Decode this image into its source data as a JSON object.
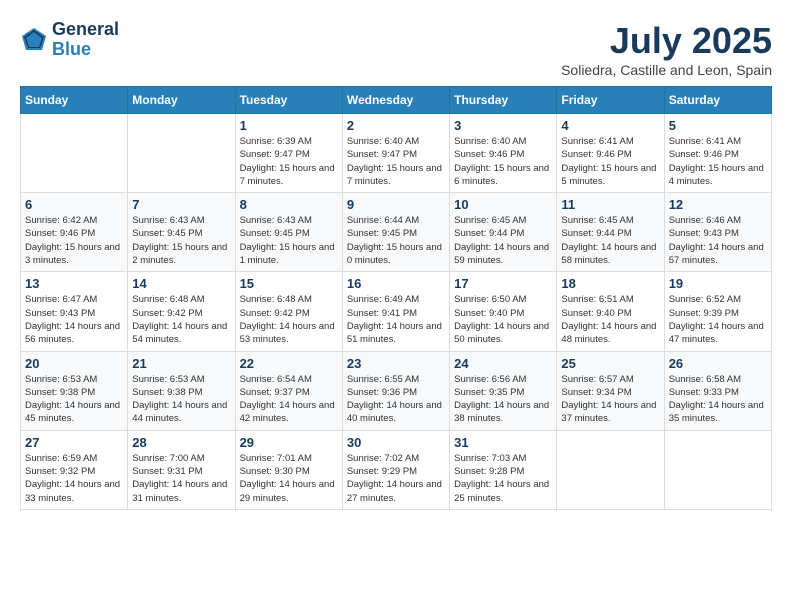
{
  "header": {
    "logo_line1": "General",
    "logo_line2": "Blue",
    "month": "July 2025",
    "location": "Soliedra, Castille and Leon, Spain"
  },
  "weekdays": [
    "Sunday",
    "Monday",
    "Tuesday",
    "Wednesday",
    "Thursday",
    "Friday",
    "Saturday"
  ],
  "weeks": [
    [
      {
        "day": null
      },
      {
        "day": null
      },
      {
        "day": "1",
        "sunrise": "Sunrise: 6:39 AM",
        "sunset": "Sunset: 9:47 PM",
        "daylight": "Daylight: 15 hours and 7 minutes."
      },
      {
        "day": "2",
        "sunrise": "Sunrise: 6:40 AM",
        "sunset": "Sunset: 9:47 PM",
        "daylight": "Daylight: 15 hours and 7 minutes."
      },
      {
        "day": "3",
        "sunrise": "Sunrise: 6:40 AM",
        "sunset": "Sunset: 9:46 PM",
        "daylight": "Daylight: 15 hours and 6 minutes."
      },
      {
        "day": "4",
        "sunrise": "Sunrise: 6:41 AM",
        "sunset": "Sunset: 9:46 PM",
        "daylight": "Daylight: 15 hours and 5 minutes."
      },
      {
        "day": "5",
        "sunrise": "Sunrise: 6:41 AM",
        "sunset": "Sunset: 9:46 PM",
        "daylight": "Daylight: 15 hours and 4 minutes."
      }
    ],
    [
      {
        "day": "6",
        "sunrise": "Sunrise: 6:42 AM",
        "sunset": "Sunset: 9:46 PM",
        "daylight": "Daylight: 15 hours and 3 minutes."
      },
      {
        "day": "7",
        "sunrise": "Sunrise: 6:43 AM",
        "sunset": "Sunset: 9:45 PM",
        "daylight": "Daylight: 15 hours and 2 minutes."
      },
      {
        "day": "8",
        "sunrise": "Sunrise: 6:43 AM",
        "sunset": "Sunset: 9:45 PM",
        "daylight": "Daylight: 15 hours and 1 minute."
      },
      {
        "day": "9",
        "sunrise": "Sunrise: 6:44 AM",
        "sunset": "Sunset: 9:45 PM",
        "daylight": "Daylight: 15 hours and 0 minutes."
      },
      {
        "day": "10",
        "sunrise": "Sunrise: 6:45 AM",
        "sunset": "Sunset: 9:44 PM",
        "daylight": "Daylight: 14 hours and 59 minutes."
      },
      {
        "day": "11",
        "sunrise": "Sunrise: 6:45 AM",
        "sunset": "Sunset: 9:44 PM",
        "daylight": "Daylight: 14 hours and 58 minutes."
      },
      {
        "day": "12",
        "sunrise": "Sunrise: 6:46 AM",
        "sunset": "Sunset: 9:43 PM",
        "daylight": "Daylight: 14 hours and 57 minutes."
      }
    ],
    [
      {
        "day": "13",
        "sunrise": "Sunrise: 6:47 AM",
        "sunset": "Sunset: 9:43 PM",
        "daylight": "Daylight: 14 hours and 56 minutes."
      },
      {
        "day": "14",
        "sunrise": "Sunrise: 6:48 AM",
        "sunset": "Sunset: 9:42 PM",
        "daylight": "Daylight: 14 hours and 54 minutes."
      },
      {
        "day": "15",
        "sunrise": "Sunrise: 6:48 AM",
        "sunset": "Sunset: 9:42 PM",
        "daylight": "Daylight: 14 hours and 53 minutes."
      },
      {
        "day": "16",
        "sunrise": "Sunrise: 6:49 AM",
        "sunset": "Sunset: 9:41 PM",
        "daylight": "Daylight: 14 hours and 51 minutes."
      },
      {
        "day": "17",
        "sunrise": "Sunrise: 6:50 AM",
        "sunset": "Sunset: 9:40 PM",
        "daylight": "Daylight: 14 hours and 50 minutes."
      },
      {
        "day": "18",
        "sunrise": "Sunrise: 6:51 AM",
        "sunset": "Sunset: 9:40 PM",
        "daylight": "Daylight: 14 hours and 48 minutes."
      },
      {
        "day": "19",
        "sunrise": "Sunrise: 6:52 AM",
        "sunset": "Sunset: 9:39 PM",
        "daylight": "Daylight: 14 hours and 47 minutes."
      }
    ],
    [
      {
        "day": "20",
        "sunrise": "Sunrise: 6:53 AM",
        "sunset": "Sunset: 9:38 PM",
        "daylight": "Daylight: 14 hours and 45 minutes."
      },
      {
        "day": "21",
        "sunrise": "Sunrise: 6:53 AM",
        "sunset": "Sunset: 9:38 PM",
        "daylight": "Daylight: 14 hours and 44 minutes."
      },
      {
        "day": "22",
        "sunrise": "Sunrise: 6:54 AM",
        "sunset": "Sunset: 9:37 PM",
        "daylight": "Daylight: 14 hours and 42 minutes."
      },
      {
        "day": "23",
        "sunrise": "Sunrise: 6:55 AM",
        "sunset": "Sunset: 9:36 PM",
        "daylight": "Daylight: 14 hours and 40 minutes."
      },
      {
        "day": "24",
        "sunrise": "Sunrise: 6:56 AM",
        "sunset": "Sunset: 9:35 PM",
        "daylight": "Daylight: 14 hours and 38 minutes."
      },
      {
        "day": "25",
        "sunrise": "Sunrise: 6:57 AM",
        "sunset": "Sunset: 9:34 PM",
        "daylight": "Daylight: 14 hours and 37 minutes."
      },
      {
        "day": "26",
        "sunrise": "Sunrise: 6:58 AM",
        "sunset": "Sunset: 9:33 PM",
        "daylight": "Daylight: 14 hours and 35 minutes."
      }
    ],
    [
      {
        "day": "27",
        "sunrise": "Sunrise: 6:59 AM",
        "sunset": "Sunset: 9:32 PM",
        "daylight": "Daylight: 14 hours and 33 minutes."
      },
      {
        "day": "28",
        "sunrise": "Sunrise: 7:00 AM",
        "sunset": "Sunset: 9:31 PM",
        "daylight": "Daylight: 14 hours and 31 minutes."
      },
      {
        "day": "29",
        "sunrise": "Sunrise: 7:01 AM",
        "sunset": "Sunset: 9:30 PM",
        "daylight": "Daylight: 14 hours and 29 minutes."
      },
      {
        "day": "30",
        "sunrise": "Sunrise: 7:02 AM",
        "sunset": "Sunset: 9:29 PM",
        "daylight": "Daylight: 14 hours and 27 minutes."
      },
      {
        "day": "31",
        "sunrise": "Sunrise: 7:03 AM",
        "sunset": "Sunset: 9:28 PM",
        "daylight": "Daylight: 14 hours and 25 minutes."
      },
      {
        "day": null
      },
      {
        "day": null
      }
    ]
  ]
}
